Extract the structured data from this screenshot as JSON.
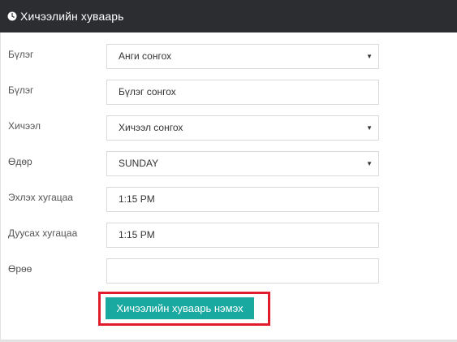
{
  "header": {
    "title": "Хичээлийн хуваарь",
    "icon": "clock-icon"
  },
  "form": {
    "fields": [
      {
        "label": "Бүлэг",
        "type": "select",
        "value": "Анги сонгох"
      },
      {
        "label": "Бүлэг",
        "type": "select",
        "value": "Бүлэг сонгох"
      },
      {
        "label": "Хичээл",
        "type": "select",
        "value": "Хичээл сонгох"
      },
      {
        "label": "Өдөр",
        "type": "select",
        "value": "SUNDAY"
      },
      {
        "label": "Эхлэх хугацаа",
        "type": "text",
        "value": "1:15 PM"
      },
      {
        "label": "Дуусах хугацаа",
        "type": "text",
        "value": "1:15 PM"
      },
      {
        "label": "Өрөө",
        "type": "text",
        "value": ""
      }
    ],
    "submit_label": "Хичээлийн хуваарь нэмэх"
  },
  "colors": {
    "header_bg": "#2b2d31",
    "button_bg": "#1aa9a1",
    "highlight_border": "#e21b2c"
  }
}
